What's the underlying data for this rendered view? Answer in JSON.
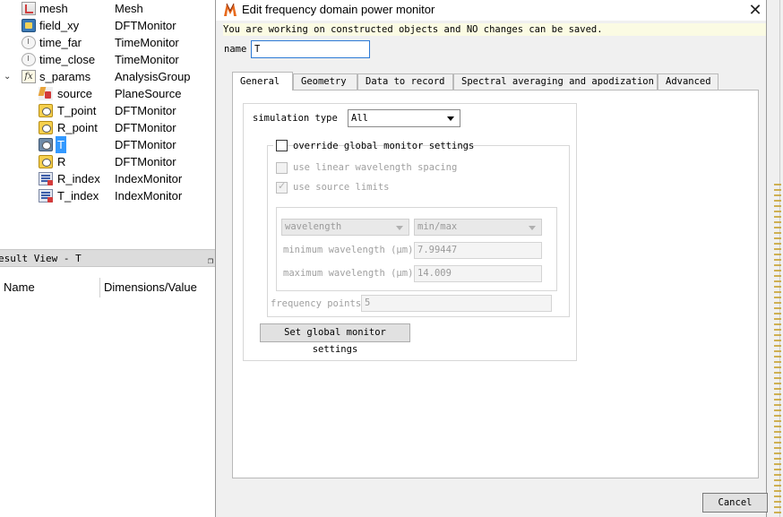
{
  "tree": {
    "items": [
      {
        "name": "mesh",
        "type": "Mesh",
        "icon": "mesh-icon"
      },
      {
        "name": "field_xy",
        "type": "DFTMonitor",
        "icon": "dft-monitor-icon"
      },
      {
        "name": "time_far",
        "type": "TimeMonitor",
        "icon": "time-monitor-icon"
      },
      {
        "name": "time_close",
        "type": "TimeMonitor",
        "icon": "time-monitor-icon"
      },
      {
        "name": "s_params",
        "type": "AnalysisGroup",
        "icon": "analysis-group-icon"
      },
      {
        "name": "source",
        "type": "PlaneSource",
        "icon": "plane-source-icon"
      },
      {
        "name": "T_point",
        "type": "DFTMonitor",
        "icon": "dft-monitor-icon"
      },
      {
        "name": "R_point",
        "type": "DFTMonitor",
        "icon": "dft-monitor-icon"
      },
      {
        "name": "T",
        "type": "DFTMonitor",
        "icon": "dft-monitor-icon"
      },
      {
        "name": "R",
        "type": "DFTMonitor",
        "icon": "dft-monitor-icon"
      },
      {
        "name": "R_index",
        "type": "IndexMonitor",
        "icon": "index-monitor-icon"
      },
      {
        "name": "T_index",
        "type": "IndexMonitor",
        "icon": "index-monitor-icon"
      }
    ],
    "expand_arrow": "⌄"
  },
  "result_view": {
    "title": "esult View - T",
    "col_name": "Name",
    "col_dims": "Dimensions/Value"
  },
  "dialog": {
    "title": "Edit frequency domain power monitor",
    "close_glyph": "✕",
    "warning": "You are working on constructed objects and NO changes can be saved.",
    "name_label": "name",
    "name_value": "T",
    "tabs": [
      "General",
      "Geometry",
      "Data to record",
      "Spectral averaging and apodization",
      "Advanced"
    ],
    "active_tab": "General",
    "general": {
      "sim_type_label": "simulation type",
      "sim_type_value": "All",
      "override_label": "override global monitor settings",
      "linear_label": "use linear wavelength spacing",
      "source_limits_label": "use source limits",
      "range_mode": "wavelength",
      "range_type": "min/max",
      "min_label": "minimum wavelength (μm)",
      "min_value": "7.99447",
      "max_label": "maximum wavelength (μm)",
      "max_value": "14.009",
      "freq_points_label": "frequency points",
      "freq_points_value": "5",
      "set_global_label": "Set global monitor settings"
    },
    "cancel_label": "Cancel"
  },
  "colors": {
    "selection": "#3399ff",
    "input_focus_border": "#2c7ad6",
    "warning_bg": "#fbfbe3",
    "logo_orange": "#e86a1c"
  }
}
